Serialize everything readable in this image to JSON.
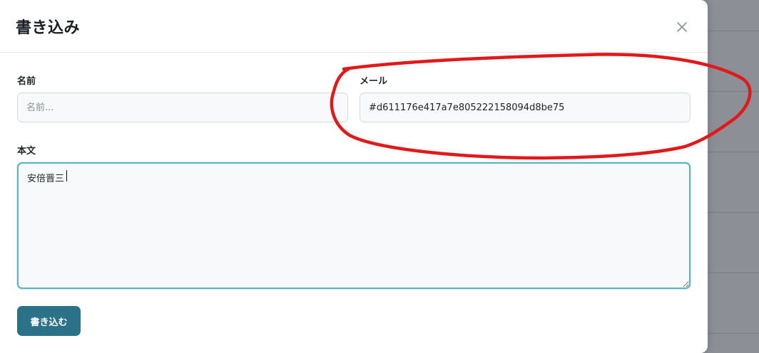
{
  "modal": {
    "title": "書き込み",
    "close_icon": "close-icon"
  },
  "form": {
    "name": {
      "label": "名前",
      "placeholder": "名前...",
      "value": ""
    },
    "email": {
      "label": "メール",
      "value": "#d611176e417a7e805222158094d8be75"
    },
    "body": {
      "label": "本文",
      "value": "安倍晋三"
    },
    "submit_label": "書き込む"
  },
  "colors": {
    "submit_button": "#2b7289",
    "focus_border": "#5ab4c4",
    "annotation_red": "#e0191b",
    "backdrop": "#8b8e95"
  }
}
